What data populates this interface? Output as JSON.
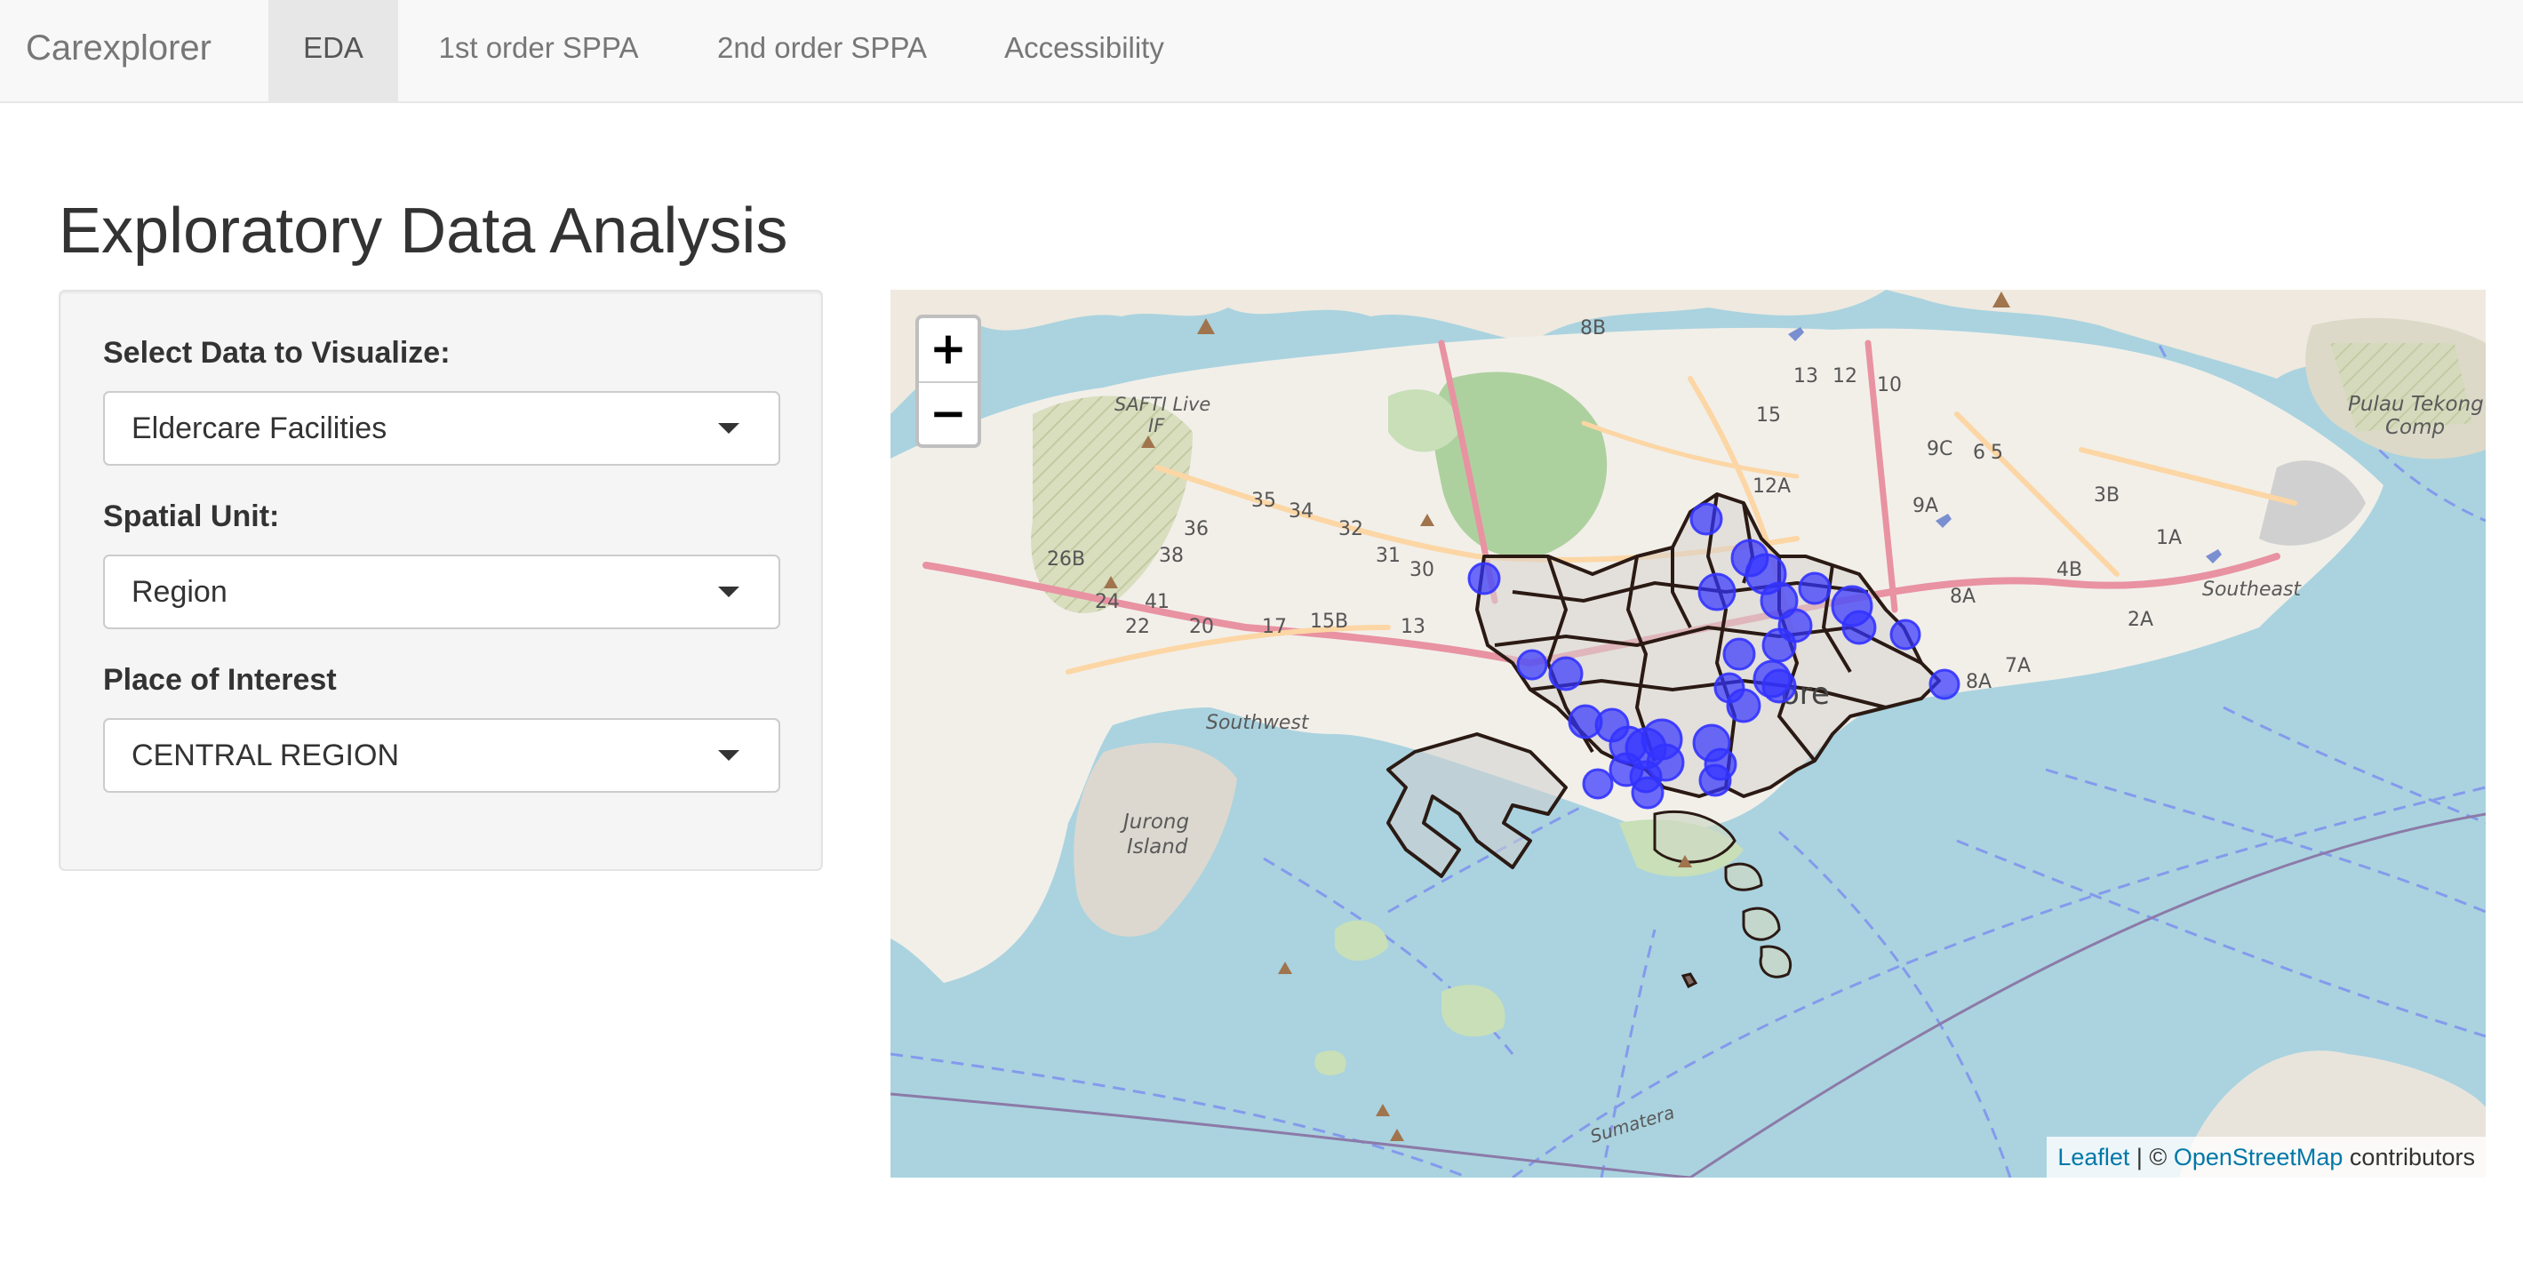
{
  "navbar": {
    "brand": "Carexplorer",
    "tabs": [
      {
        "label": "EDA",
        "active": true
      },
      {
        "label": "1st order SPPA",
        "active": false
      },
      {
        "label": "2nd order SPPA",
        "active": false
      },
      {
        "label": "Accessibility",
        "active": false
      }
    ]
  },
  "page": {
    "title": "Exploratory Data Analysis"
  },
  "sidebar": {
    "data_label": "Select Data to Visualize:",
    "data_value": "Eldercare Facilities",
    "unit_label": "Spatial Unit:",
    "unit_value": "Region",
    "poi_label": "Place of Interest",
    "poi_value": "CENTRAL REGION"
  },
  "map": {
    "zoom_in": "+",
    "zoom_out": "−",
    "attribution": {
      "leaflet": "Leaflet",
      "separator": " | © ",
      "osm": "OpenStreetMap",
      "contributors": " contributors"
    },
    "place_labels": [
      "SAFTI Live",
      "IF",
      "Southwest",
      "Jurong",
      "Island",
      "Southeast",
      "Pulau Tekong",
      "Comp",
      "Sumatera",
      "ore"
    ],
    "road_labels": [
      "26B",
      "24",
      "41",
      "22",
      "20",
      "17",
      "15B",
      "13",
      "38",
      "36",
      "35",
      "34",
      "32",
      "31",
      "30",
      "8B",
      "13",
      "12",
      "10",
      "15",
      "12A",
      "9A",
      "9C",
      "6",
      "5",
      "3B",
      "1A",
      "4B",
      "2A",
      "8A",
      "7A",
      "8A"
    ],
    "colors": {
      "water": "#aad3df",
      "land": "#f2efe9",
      "facility_marker": "#3333ff",
      "boundary": "#2b1a14"
    }
  }
}
